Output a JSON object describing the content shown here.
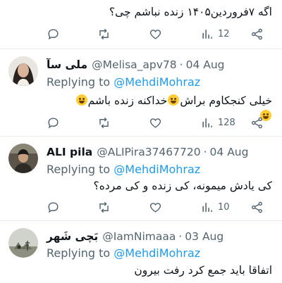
{
  "tweets": [
    {
      "text": "اگه ۷فروردین۱۴۰۵ زنده نباشم چی؟",
      "views": "12"
    },
    {
      "name": "ملی سآ",
      "handle": "@Melisa_apv78",
      "date": "04 Aug",
      "replying_label": "Replying to",
      "replying_to": "@MehdiMohraz",
      "text_part1": "خیلی کنجکاوم براش",
      "text_part2": "خداکنه زنده باشم",
      "views": "128"
    },
    {
      "name": "ALI pila",
      "handle": "@ALIPira37467720",
      "date": "04 Aug",
      "replying_label": "Replying to",
      "replying_to": "@MehdiMohraz",
      "text": "کی یادش میمونه، کی زنده و کی مرده؟",
      "views": "10"
    },
    {
      "name": "بَچی شَهر",
      "handle": "@IamNimaaa",
      "date": "03 Aug",
      "replying_label": "Replying to",
      "replying_to": "@MehdiMohraz",
      "text": "اتفاقا باید جمع کرد رفت بیرون"
    }
  ],
  "separator": "·",
  "icons": [
    "reply-icon",
    "retweet-icon",
    "like-icon",
    "views-icon",
    "share-icon"
  ],
  "colors": {
    "text": "#0f1419",
    "muted": "#536471",
    "link": "#1d9bf0",
    "divider": "#e6ecf0"
  }
}
